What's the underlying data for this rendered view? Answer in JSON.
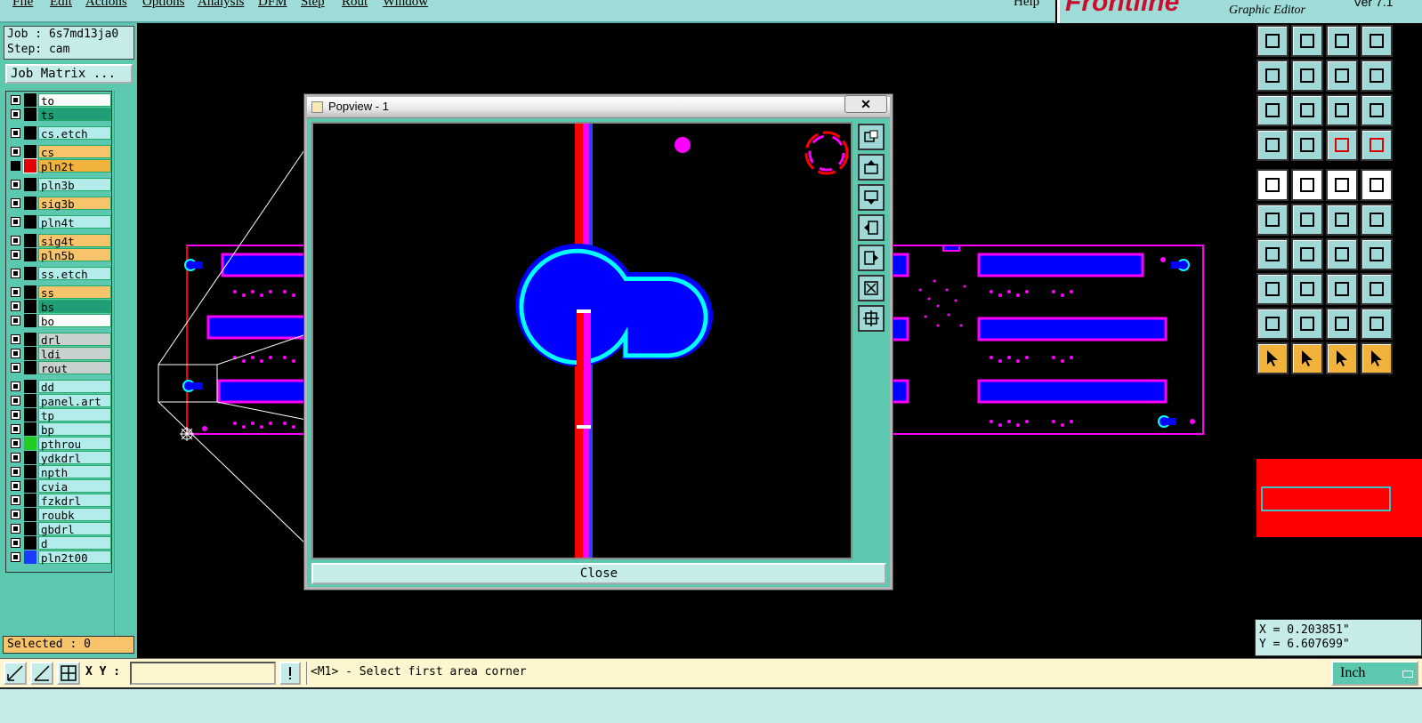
{
  "menubar": {
    "items": [
      "File",
      "Edit",
      "Actions",
      "Options",
      "Analysis",
      "DFM",
      "Step",
      "Rout",
      "Window"
    ],
    "help": "Help"
  },
  "brand": {
    "logo": "Frontline",
    "subtitle": "Graphic Editor",
    "version": "Ver 7.1"
  },
  "job": {
    "job_label": "Job : 6s7md13ja0",
    "step_label": "Step: cam",
    "matrix_button": "Job Matrix ..."
  },
  "layers": [
    {
      "name": "to",
      "color": "#ffffff",
      "group": 0
    },
    {
      "name": "ts",
      "color": "#1f9e78",
      "group": 0
    },
    {
      "name": "cs.etch",
      "color": "#b4ecec",
      "group": 1
    },
    {
      "name": "cs",
      "color": "#f7c36b",
      "group": 2
    },
    {
      "name": "pln2t",
      "color": "#f2b33d",
      "group": 2,
      "swatch": "#e00000",
      "active": true
    },
    {
      "name": "pln3b",
      "color": "#b4ecec",
      "group": 3
    },
    {
      "name": "sig3b",
      "color": "#f7c36b",
      "group": 4
    },
    {
      "name": "pln4t",
      "color": "#b4ecec",
      "group": 5
    },
    {
      "name": "sig4t",
      "color": "#f7c36b",
      "group": 6
    },
    {
      "name": "pln5b",
      "color": "#f7c36b",
      "group": 6
    },
    {
      "name": "ss.etch",
      "color": "#b4ecec",
      "group": 7
    },
    {
      "name": "ss",
      "color": "#f7c36b",
      "group": 8
    },
    {
      "name": "bs",
      "color": "#1f9e78",
      "group": 8
    },
    {
      "name": "bo",
      "color": "#ffffff",
      "group": 8
    },
    {
      "name": "drl",
      "color": "#c8d0d0",
      "group": 9
    },
    {
      "name": "ldi",
      "color": "#c8d0d0",
      "group": 9
    },
    {
      "name": "rout",
      "color": "#c8d0d0",
      "group": 9
    },
    {
      "name": "dd",
      "color": "#b4ecec",
      "group": 10
    },
    {
      "name": "panel.art",
      "color": "#b4ecec",
      "group": 10
    },
    {
      "name": "tp",
      "color": "#b4ecec",
      "group": 10
    },
    {
      "name": "bp",
      "color": "#b4ecec",
      "group": 10
    },
    {
      "name": "pthrou",
      "color": "#b4ecec",
      "group": 10,
      "swatch": "#22cc22"
    },
    {
      "name": "ydkdrl",
      "color": "#b4ecec",
      "group": 10
    },
    {
      "name": "npth",
      "color": "#b4ecec",
      "group": 10
    },
    {
      "name": "cvia",
      "color": "#b4ecec",
      "group": 10
    },
    {
      "name": "fzkdrl",
      "color": "#b4ecec",
      "group": 10
    },
    {
      "name": "roubk",
      "color": "#b4ecec",
      "group": 10
    },
    {
      "name": "gbdrl",
      "color": "#b4ecec",
      "group": 10
    },
    {
      "name": "d",
      "color": "#b4ecec",
      "group": 10
    },
    {
      "name": "pln2t00",
      "color": "#b4ecec",
      "group": 10,
      "swatch": "#1a3cff"
    }
  ],
  "selected_label": "Selected : 0",
  "popup": {
    "title": "Popview - 1",
    "close_x": "✕",
    "close_button": "Close"
  },
  "coords": {
    "x": "X = 0.203851\"",
    "y": "Y = 6.607699\""
  },
  "bottom": {
    "xy_label": "X Y :",
    "xy_value": "",
    "prompt": "<M1> - Select first area corner",
    "unit": "Inch"
  },
  "colors": {
    "panel": "#5cc8b0",
    "light": "#c6ecea",
    "copper_magenta": "#ff00ff",
    "fill_blue": "#0000ff",
    "pad_cyan": "#00ffff",
    "red": "#ff0000",
    "accent_yellow": "#f2b33d"
  }
}
